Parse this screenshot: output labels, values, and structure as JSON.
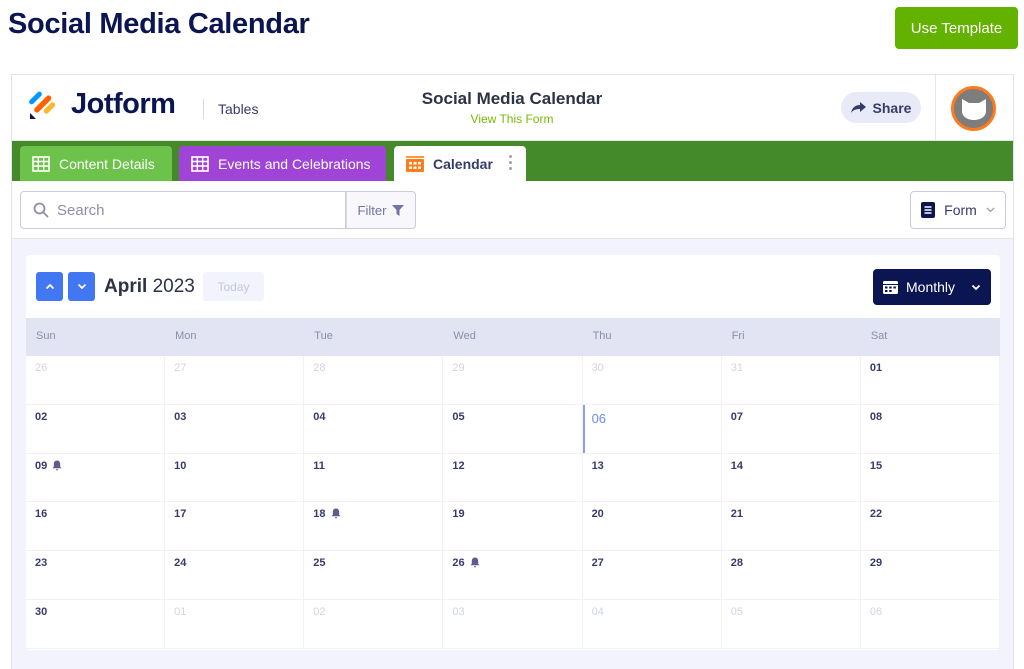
{
  "page": {
    "title": "Social Media Calendar",
    "use_template_label": "Use Template"
  },
  "app": {
    "brand": "Jotform",
    "section": "Tables",
    "form_title": "Social Media Calendar",
    "view_form_link": "View This Form",
    "share_label": "Share"
  },
  "tabs": [
    {
      "label": "Content Details",
      "icon": "table-grid-icon",
      "color": "#6cc24a"
    },
    {
      "label": "Events and Celebrations",
      "icon": "table-grid-icon",
      "color": "#a044d8"
    },
    {
      "label": "Calendar",
      "icon": "calendar-icon",
      "active": true
    }
  ],
  "toolbar": {
    "search_placeholder": "Search",
    "filter_label": "Filter",
    "form_label": "Form"
  },
  "calendar": {
    "month": "April",
    "year": "2023",
    "today_label": "Today",
    "view_label": "Monthly",
    "weekdays": [
      "Sun",
      "Mon",
      "Tue",
      "Wed",
      "Thu",
      "Fri",
      "Sat"
    ],
    "today": "06",
    "days": [
      {
        "d": "26",
        "other": true
      },
      {
        "d": "27",
        "other": true
      },
      {
        "d": "28",
        "other": true
      },
      {
        "d": "29",
        "other": true
      },
      {
        "d": "30",
        "other": true
      },
      {
        "d": "31",
        "other": true
      },
      {
        "d": "01"
      },
      {
        "d": "02"
      },
      {
        "d": "03"
      },
      {
        "d": "04"
      },
      {
        "d": "05"
      },
      {
        "d": "06",
        "today": true
      },
      {
        "d": "07"
      },
      {
        "d": "08"
      },
      {
        "d": "09",
        "bell": true
      },
      {
        "d": "10"
      },
      {
        "d": "11"
      },
      {
        "d": "12"
      },
      {
        "d": "13"
      },
      {
        "d": "14"
      },
      {
        "d": "15"
      },
      {
        "d": "16"
      },
      {
        "d": "17"
      },
      {
        "d": "18",
        "bell": true
      },
      {
        "d": "19"
      },
      {
        "d": "20"
      },
      {
        "d": "21"
      },
      {
        "d": "22"
      },
      {
        "d": "23"
      },
      {
        "d": "24"
      },
      {
        "d": "25"
      },
      {
        "d": "26",
        "bell": true
      },
      {
        "d": "27"
      },
      {
        "d": "28"
      },
      {
        "d": "29"
      },
      {
        "d": "30"
      },
      {
        "d": "01",
        "other": true
      },
      {
        "d": "02",
        "other": true
      },
      {
        "d": "03",
        "other": true
      },
      {
        "d": "04",
        "other": true
      },
      {
        "d": "05",
        "other": true
      },
      {
        "d": "06",
        "other": true
      }
    ]
  }
}
